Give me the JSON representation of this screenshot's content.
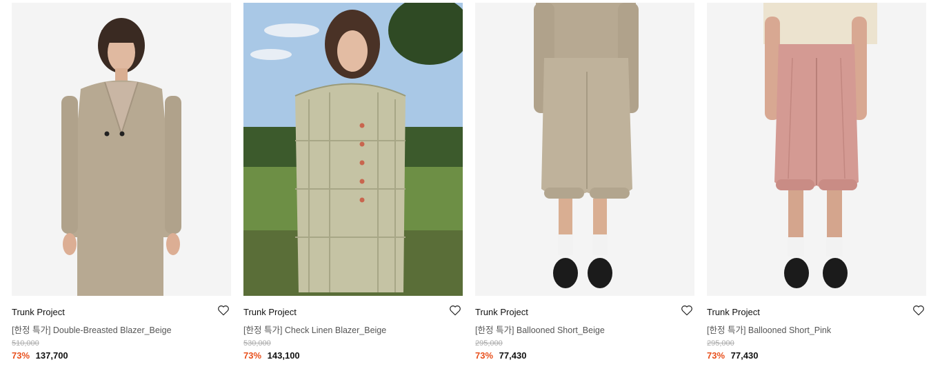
{
  "products": [
    {
      "brand": "Trunk Project",
      "name": "[한정 특가] Double-Breasted Blazer_Beige",
      "original_price": "510,000",
      "discount": "73%",
      "price": "137,700",
      "image": "model-beige-blazer",
      "colors": {
        "bg": "#f4f4f4",
        "garment": "#b7a992"
      }
    },
    {
      "brand": "Trunk Project",
      "name": "[한정 특가] Check Linen Blazer_Beige",
      "original_price": "530,000",
      "discount": "73%",
      "price": "143,100",
      "image": "model-check-blazer-outdoor",
      "colors": {
        "sky": "#a9c8e6",
        "grass": "#6d8f45",
        "garment": "#c5c3a4"
      }
    },
    {
      "brand": "Trunk Project",
      "name": "[한정 특가] Ballooned Short_Beige",
      "original_price": "295,000",
      "discount": "73%",
      "price": "77,430",
      "image": "model-beige-shorts",
      "colors": {
        "bg": "#f4f4f4",
        "garment": "#bfb29b"
      }
    },
    {
      "brand": "Trunk Project",
      "name": "[한정 특가] Ballooned Short_Pink",
      "original_price": "295,000",
      "discount": "73%",
      "price": "77,430",
      "image": "model-pink-shorts",
      "colors": {
        "bg": "#f4f4f4",
        "garment": "#d49a93"
      }
    }
  ],
  "theme": {
    "discount_color": "#e8501c",
    "wishlist_icon": "heart-outline-icon"
  }
}
